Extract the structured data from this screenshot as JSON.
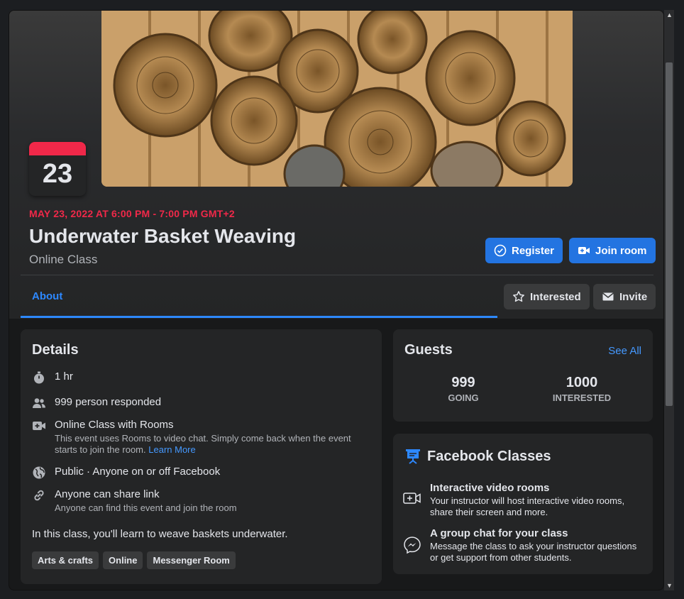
{
  "event": {
    "day": "23",
    "datetime": "MAY 23, 2022 AT 6:00 PM - 7:00 PM GMT+2",
    "title": "Underwater Basket Weaving",
    "subtitle": "Online Class"
  },
  "actions": {
    "register": "Register",
    "join_room": "Join room",
    "interested": "Interested",
    "invite": "Invite"
  },
  "tabs": [
    {
      "label": "About",
      "active": true
    }
  ],
  "details": {
    "title": "Details",
    "duration": "1 hr",
    "responded": "999 person responded",
    "rooms_title": "Online Class with Rooms",
    "rooms_desc": "This event uses Rooms to video chat. Simply come back when the event starts to join the room.",
    "learn_more": "Learn More",
    "privacy": "Public · Anyone on or off Facebook",
    "share_title": "Anyone can share link",
    "share_desc": "Anyone can find this event and join the room",
    "description": "In this class, you'll learn to weave baskets underwater.",
    "tags": [
      "Arts & crafts",
      "Online",
      "Messenger Room"
    ]
  },
  "guests": {
    "title": "Guests",
    "see_all": "See All",
    "going_count": "999",
    "going_label": "GOING",
    "interested_count": "1000",
    "interested_label": "INTERESTED"
  },
  "classes": {
    "title": "Facebook Classes",
    "features": [
      {
        "title": "Interactive video rooms",
        "desc": "Your instructor will host interactive video rooms, share their screen and more."
      },
      {
        "title": "A group chat for your class",
        "desc": "Message the class to ask your instructor questions or get support from other students."
      }
    ]
  },
  "colors": {
    "accent": "#2374e1",
    "date_red": "#f02849",
    "link": "#4599ff"
  }
}
